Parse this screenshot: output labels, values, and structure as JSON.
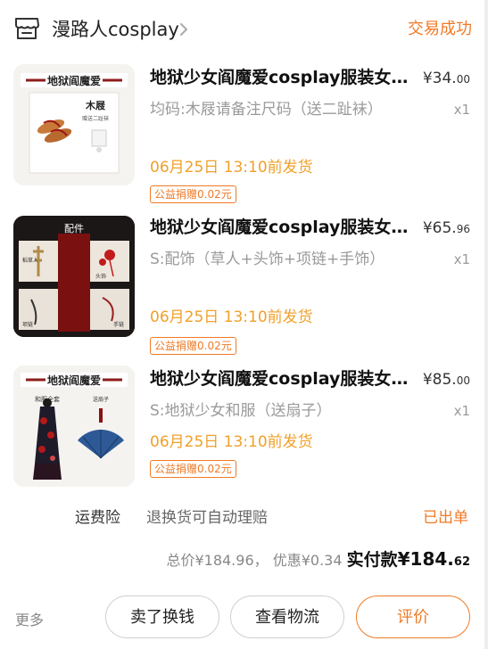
{
  "shop": {
    "name": "漫路人cosplay",
    "icon": "shop-icon"
  },
  "order": {
    "status": "交易成功"
  },
  "items": [
    {
      "title": "地狱少女阎魔爱cosplay服装女…",
      "price_main": "¥34.",
      "price_cents": "00",
      "spec": "均码:木屐请备注尺码（送二趾袜）",
      "qty": "x1",
      "delivery": "06月25日 13:10前发货",
      "charity": "公益捐赠0.02元",
      "thumb": {
        "banner": "地狱阎魔爱",
        "label": "木屐",
        "sub": "赠送二趾袜"
      }
    },
    {
      "title": "地狱少女阎魔爱cosplay服装女…",
      "price_main": "¥65.",
      "price_cents": "96",
      "spec": "S:配饰（草人+头饰+项链+手饰）",
      "qty": "x1",
      "delivery": "06月25日 13:10前发货",
      "charity": "公益捐赠0.02元",
      "thumb": {
        "banner": "配件",
        "label_a": "稻草人",
        "label_b": "头饰",
        "label_c": "项链",
        "label_d": "手链"
      }
    },
    {
      "title": "地狱少女阎魔爱cosplay服装女…",
      "price_main": "¥85.",
      "price_cents": "00",
      "spec": "S:地狱少女和服（送扇子）",
      "qty": "x1",
      "delivery": "06月25日 13:10前发货",
      "charity": "公益捐赠0.02元",
      "thumb": {
        "banner": "地狱阎魔爱",
        "label": "和服全套",
        "sub": "送扇子"
      }
    }
  ],
  "insurance": {
    "label": "运费险",
    "desc": "退换货可自动理赔",
    "status": "已出单"
  },
  "totals": {
    "total": "总价¥184.96，",
    "discount": "优惠¥0.34",
    "paid_label": "实付款",
    "paid_main": "¥184.",
    "paid_cents": "62"
  },
  "actions": {
    "more": "更多",
    "sell": "卖了换钱",
    "logistics": "查看物流",
    "review": "评价"
  },
  "colors": {
    "accent": "#f07a26",
    "delivery": "#f0a02a"
  }
}
